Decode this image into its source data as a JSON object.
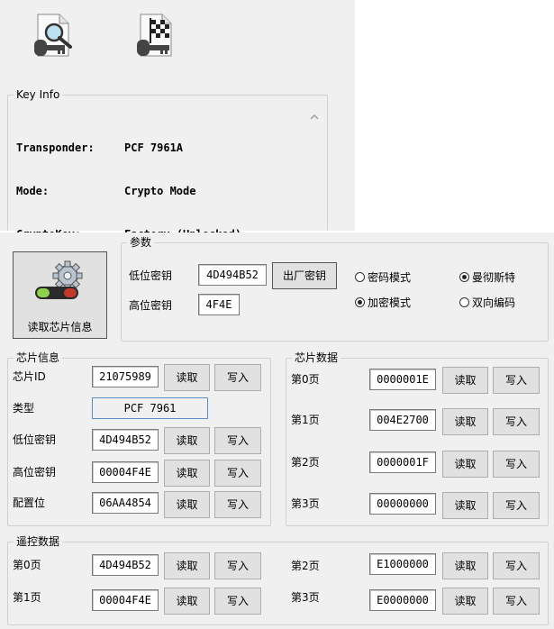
{
  "key_info": {
    "title": "Key Info",
    "rows": [
      {
        "label": "Transponder:",
        "value": "PCF 7961A"
      },
      {
        "label": "Mode:",
        "value": "Crypto Mode"
      },
      {
        "label": "CryptoKey:",
        "value": "Factory (Unlocked)"
      }
    ]
  },
  "toolbar": {
    "icons": [
      "key-search-icon",
      "key-flag-icon"
    ]
  },
  "read_chip": {
    "label": "读取芯片信息",
    "icon": "gear-icon"
  },
  "params": {
    "title": "参数",
    "low_key_label": "低位密钥",
    "low_key_value": "4D494B52",
    "factory_key_label": "出厂密钥",
    "high_key_label": "高位密钥",
    "high_key_value": "4F4E",
    "radios": [
      {
        "label": "密码模式",
        "checked": false
      },
      {
        "label": "曼彻斯特",
        "checked": true
      },
      {
        "label": "加密模式",
        "checked": true
      },
      {
        "label": "双向编码",
        "checked": false
      }
    ]
  },
  "chip_info": {
    "title": "芯片信息",
    "read_label": "读取",
    "write_label": "写入",
    "chip_id_label": "芯片ID",
    "chip_id_value": "21075989",
    "type_label": "类型",
    "type_value": "PCF 7961",
    "low_key_label": "低位密钥",
    "low_key_value": "4D494B52",
    "high_key_label": "高位密钥",
    "high_key_value": "00004F4E",
    "config_label": "配置位",
    "config_value": "06AA4854"
  },
  "chip_data": {
    "title": "芯片数据",
    "read_label": "读取",
    "write_label": "写入",
    "pages": [
      {
        "label": "第0页",
        "value": "0000001E"
      },
      {
        "label": "第1页",
        "value": "004E2700"
      },
      {
        "label": "第2页",
        "value": "0000001F"
      },
      {
        "label": "第3页",
        "value": "00000000"
      }
    ]
  },
  "remote_data": {
    "title": "遥控数据",
    "read_label": "读取",
    "write_label": "写入",
    "pages": [
      {
        "label": "第0页",
        "value": "4D494B52"
      },
      {
        "label": "第1页",
        "value": "00004F4E"
      },
      {
        "label": "第2页",
        "value": "E1000000"
      },
      {
        "label": "第3页",
        "value": "E0000000"
      }
    ]
  }
}
